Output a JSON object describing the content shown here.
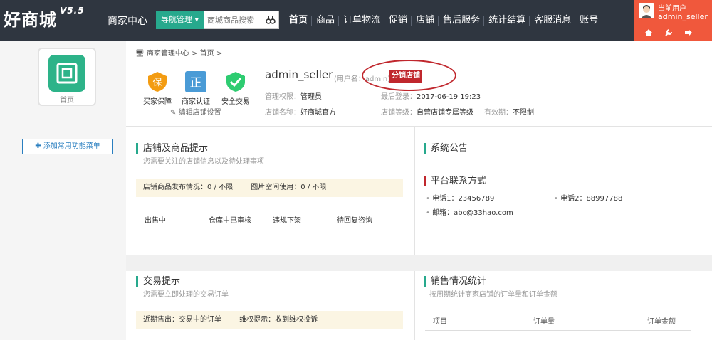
{
  "header": {
    "logo": "好商城",
    "version": "V5.5",
    "merchant_center": "商家中心",
    "nav_manage": "导航管理",
    "search_placeholder": "商城商品搜索",
    "nav": [
      "首页",
      "商品",
      "订单物流",
      "促销",
      "店铺",
      "售后服务",
      "统计结算",
      "客服消息",
      "账号"
    ],
    "user_label": "当前用户",
    "user_name": "admin_seller"
  },
  "sidebar": {
    "home_label": "首页",
    "add_menu": "添加常用功能菜单"
  },
  "breadcrumb": {
    "root": "商家管理中心",
    "sep": ">",
    "current": "首页"
  },
  "badges": [
    "买家保障",
    "商家认证",
    "安全交易"
  ],
  "edit_shop": "编辑店铺设置",
  "profile": {
    "seller": "admin_seller",
    "username_label": "(用户名：admin)",
    "tag": "分销店铺",
    "role_label": "管理权限：",
    "role": "管理员",
    "last_login_label": "最后登录：",
    "last_login": "2017-06-19 19:23",
    "shop_name_label": "店铺名称：",
    "shop_name": "好商城官方",
    "shop_level_label": "店铺等级：",
    "shop_level": "自营店铺专属等级",
    "valid_label": "有效期：",
    "valid": "不限制"
  },
  "shop_tips": {
    "title": "店铺及商品提示",
    "subtitle": "您需要关注的店铺信息以及待处理事项",
    "publish": "店铺商品发布情况：0 / 不限",
    "space": "图片空间使用：0 / 不限",
    "stats": [
      "出售中",
      "仓库中已审核",
      "违规下架",
      "待回复咨询"
    ]
  },
  "announcement": {
    "title": "系统公告"
  },
  "contact": {
    "title": "平台联系方式",
    "phone1": "电话1：23456789",
    "phone2": "电话2：88997788",
    "email": "邮箱：abc@33hao.com"
  },
  "trade_tips": {
    "title": "交易提示",
    "subtitle": "您需要立即处理的交易订单",
    "recent": "近期售出：交易中的订单",
    "rights": "维权提示：收到维权投诉"
  },
  "sales": {
    "title": "销售情况统计",
    "subtitle": "按周期统计商家店铺的订单量和订单金额",
    "columns": [
      "项目",
      "订单量",
      "订单金额"
    ]
  }
}
